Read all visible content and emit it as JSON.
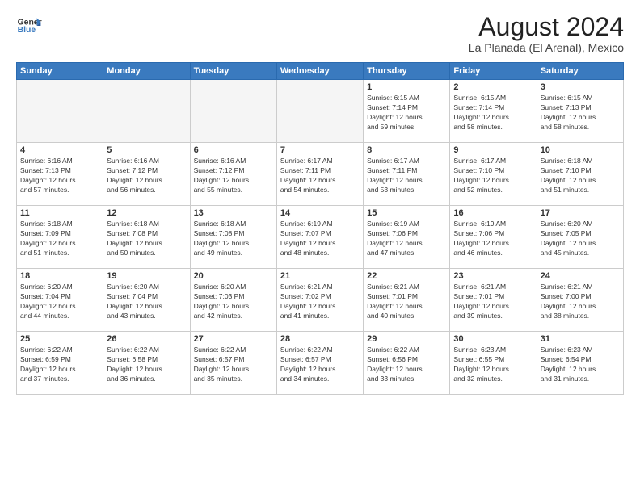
{
  "header": {
    "logo_text_line1": "General",
    "logo_text_line2": "Blue",
    "month_year": "August 2024",
    "location": "La Planada (El Arenal), Mexico"
  },
  "weekdays": [
    "Sunday",
    "Monday",
    "Tuesday",
    "Wednesday",
    "Thursday",
    "Friday",
    "Saturday"
  ],
  "weeks": [
    [
      {
        "day": "",
        "info": "",
        "empty": true
      },
      {
        "day": "",
        "info": "",
        "empty": true
      },
      {
        "day": "",
        "info": "",
        "empty": true
      },
      {
        "day": "",
        "info": "",
        "empty": true
      },
      {
        "day": "1",
        "info": "Sunrise: 6:15 AM\nSunset: 7:14 PM\nDaylight: 12 hours\nand 59 minutes."
      },
      {
        "day": "2",
        "info": "Sunrise: 6:15 AM\nSunset: 7:14 PM\nDaylight: 12 hours\nand 58 minutes."
      },
      {
        "day": "3",
        "info": "Sunrise: 6:15 AM\nSunset: 7:13 PM\nDaylight: 12 hours\nand 58 minutes."
      }
    ],
    [
      {
        "day": "4",
        "info": "Sunrise: 6:16 AM\nSunset: 7:13 PM\nDaylight: 12 hours\nand 57 minutes."
      },
      {
        "day": "5",
        "info": "Sunrise: 6:16 AM\nSunset: 7:12 PM\nDaylight: 12 hours\nand 56 minutes."
      },
      {
        "day": "6",
        "info": "Sunrise: 6:16 AM\nSunset: 7:12 PM\nDaylight: 12 hours\nand 55 minutes."
      },
      {
        "day": "7",
        "info": "Sunrise: 6:17 AM\nSunset: 7:11 PM\nDaylight: 12 hours\nand 54 minutes."
      },
      {
        "day": "8",
        "info": "Sunrise: 6:17 AM\nSunset: 7:11 PM\nDaylight: 12 hours\nand 53 minutes."
      },
      {
        "day": "9",
        "info": "Sunrise: 6:17 AM\nSunset: 7:10 PM\nDaylight: 12 hours\nand 52 minutes."
      },
      {
        "day": "10",
        "info": "Sunrise: 6:18 AM\nSunset: 7:10 PM\nDaylight: 12 hours\nand 51 minutes."
      }
    ],
    [
      {
        "day": "11",
        "info": "Sunrise: 6:18 AM\nSunset: 7:09 PM\nDaylight: 12 hours\nand 51 minutes."
      },
      {
        "day": "12",
        "info": "Sunrise: 6:18 AM\nSunset: 7:08 PM\nDaylight: 12 hours\nand 50 minutes."
      },
      {
        "day": "13",
        "info": "Sunrise: 6:18 AM\nSunset: 7:08 PM\nDaylight: 12 hours\nand 49 minutes."
      },
      {
        "day": "14",
        "info": "Sunrise: 6:19 AM\nSunset: 7:07 PM\nDaylight: 12 hours\nand 48 minutes."
      },
      {
        "day": "15",
        "info": "Sunrise: 6:19 AM\nSunset: 7:06 PM\nDaylight: 12 hours\nand 47 minutes."
      },
      {
        "day": "16",
        "info": "Sunrise: 6:19 AM\nSunset: 7:06 PM\nDaylight: 12 hours\nand 46 minutes."
      },
      {
        "day": "17",
        "info": "Sunrise: 6:20 AM\nSunset: 7:05 PM\nDaylight: 12 hours\nand 45 minutes."
      }
    ],
    [
      {
        "day": "18",
        "info": "Sunrise: 6:20 AM\nSunset: 7:04 PM\nDaylight: 12 hours\nand 44 minutes."
      },
      {
        "day": "19",
        "info": "Sunrise: 6:20 AM\nSunset: 7:04 PM\nDaylight: 12 hours\nand 43 minutes."
      },
      {
        "day": "20",
        "info": "Sunrise: 6:20 AM\nSunset: 7:03 PM\nDaylight: 12 hours\nand 42 minutes."
      },
      {
        "day": "21",
        "info": "Sunrise: 6:21 AM\nSunset: 7:02 PM\nDaylight: 12 hours\nand 41 minutes."
      },
      {
        "day": "22",
        "info": "Sunrise: 6:21 AM\nSunset: 7:01 PM\nDaylight: 12 hours\nand 40 minutes."
      },
      {
        "day": "23",
        "info": "Sunrise: 6:21 AM\nSunset: 7:01 PM\nDaylight: 12 hours\nand 39 minutes."
      },
      {
        "day": "24",
        "info": "Sunrise: 6:21 AM\nSunset: 7:00 PM\nDaylight: 12 hours\nand 38 minutes."
      }
    ],
    [
      {
        "day": "25",
        "info": "Sunrise: 6:22 AM\nSunset: 6:59 PM\nDaylight: 12 hours\nand 37 minutes."
      },
      {
        "day": "26",
        "info": "Sunrise: 6:22 AM\nSunset: 6:58 PM\nDaylight: 12 hours\nand 36 minutes."
      },
      {
        "day": "27",
        "info": "Sunrise: 6:22 AM\nSunset: 6:57 PM\nDaylight: 12 hours\nand 35 minutes."
      },
      {
        "day": "28",
        "info": "Sunrise: 6:22 AM\nSunset: 6:57 PM\nDaylight: 12 hours\nand 34 minutes."
      },
      {
        "day": "29",
        "info": "Sunrise: 6:22 AM\nSunset: 6:56 PM\nDaylight: 12 hours\nand 33 minutes."
      },
      {
        "day": "30",
        "info": "Sunrise: 6:23 AM\nSunset: 6:55 PM\nDaylight: 12 hours\nand 32 minutes."
      },
      {
        "day": "31",
        "info": "Sunrise: 6:23 AM\nSunset: 6:54 PM\nDaylight: 12 hours\nand 31 minutes."
      }
    ]
  ]
}
